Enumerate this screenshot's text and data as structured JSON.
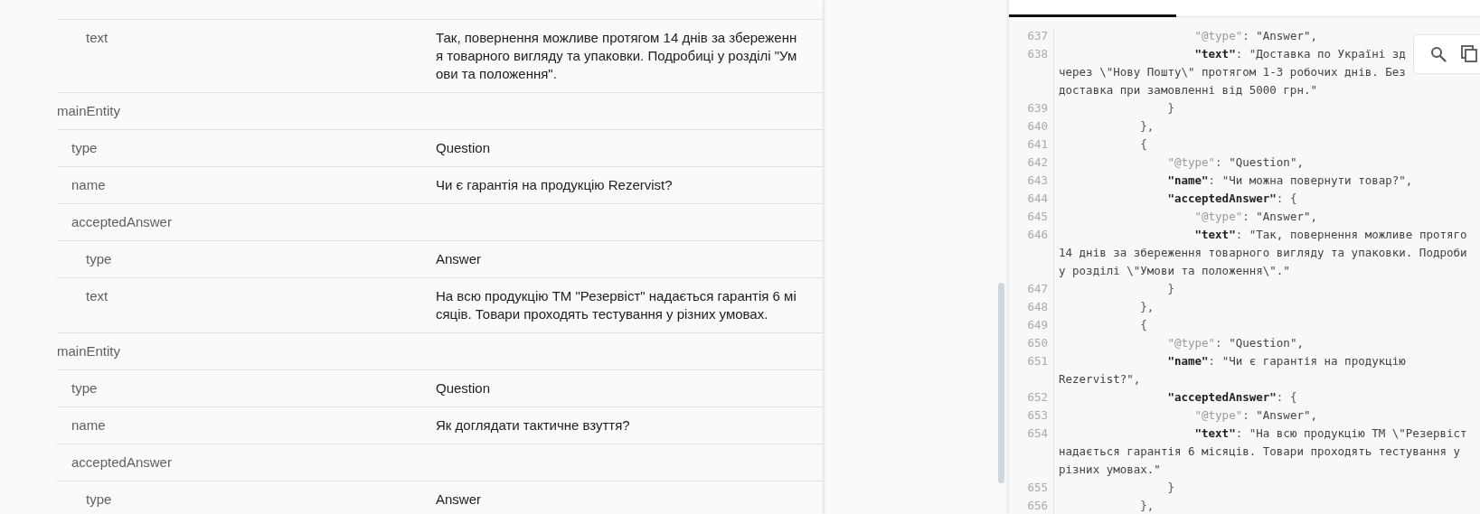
{
  "table": {
    "rows": [
      {
        "children": [
          {
            "children": [
              {
                "key": "text",
                "value": "Так, повернення можливе протягом 14 днів за збереження товарного вигляду та упаковки. Подробиці у розділі \"Умови та положення\"."
              }
            ]
          }
        ]
      },
      {
        "key": "mainEntity",
        "children": [
          {
            "key": "type",
            "value": "Question"
          },
          {
            "key": "name",
            "value": "Чи є гарантія на продукцію Rezervist?"
          },
          {
            "key": "acceptedAnswer",
            "children": [
              {
                "key": "type",
                "value": "Answer"
              },
              {
                "key": "text",
                "value": "На всю продукцію ТМ \"Резервіст\" надається гарантія 6 місяців. Товари проходять тестування у різних умовах."
              }
            ]
          }
        ]
      },
      {
        "key": "mainEntity",
        "children": [
          {
            "key": "type",
            "value": "Question"
          },
          {
            "key": "name",
            "value": "Як доглядати тактичне взуття?"
          },
          {
            "key": "acceptedAnswer",
            "children": [
              {
                "key": "type",
                "value": "Answer"
              }
            ]
          }
        ]
      }
    ]
  },
  "code": {
    "lines": [
      {
        "number": "637",
        "rows": [
          [
            {
              "kind": "meta",
              "text": "                    \"@type\""
            },
            {
              "kind": "punct",
              "text": ": "
            },
            {
              "kind": "value",
              "text": "\"Answer\","
            }
          ]
        ]
      },
      {
        "number": "638",
        "rows": [
          [
            {
              "kind": "key",
              "text": "                    \"text\""
            },
            {
              "kind": "punct",
              "text": ": "
            },
            {
              "kind": "value",
              "text": "\"Доставка по Україні зд"
            }
          ],
          [
            {
              "kind": "value",
              "text": "через \\\"Нову Пошту\\\" протягом 1-3 робочих днів. Без"
            }
          ],
          [
            {
              "kind": "value",
              "text": "доставка при замовленні від 5000 грн.\""
            }
          ]
        ]
      },
      {
        "number": "639",
        "rows": [
          [
            {
              "kind": "punct",
              "text": "                }"
            }
          ]
        ]
      },
      {
        "number": "640",
        "rows": [
          [
            {
              "kind": "punct",
              "text": "            },"
            }
          ]
        ]
      },
      {
        "number": "641",
        "rows": [
          [
            {
              "kind": "punct",
              "text": "            {"
            }
          ]
        ]
      },
      {
        "number": "642",
        "rows": [
          [
            {
              "kind": "meta",
              "text": "                \"@type\""
            },
            {
              "kind": "punct",
              "text": ": "
            },
            {
              "kind": "value",
              "text": "\"Question\","
            }
          ]
        ]
      },
      {
        "number": "643",
        "rows": [
          [
            {
              "kind": "key",
              "text": "                \"name\""
            },
            {
              "kind": "punct",
              "text": ": "
            },
            {
              "kind": "value",
              "text": "\"Чи можна повернути товар?\","
            }
          ]
        ]
      },
      {
        "number": "644",
        "rows": [
          [
            {
              "kind": "key",
              "text": "                \"acceptedAnswer\""
            },
            {
              "kind": "punct",
              "text": ": {"
            }
          ]
        ]
      },
      {
        "number": "645",
        "rows": [
          [
            {
              "kind": "meta",
              "text": "                    \"@type\""
            },
            {
              "kind": "punct",
              "text": ": "
            },
            {
              "kind": "value",
              "text": "\"Answer\","
            }
          ]
        ]
      },
      {
        "number": "646",
        "rows": [
          [
            {
              "kind": "key",
              "text": "                    \"text\""
            },
            {
              "kind": "punct",
              "text": ": "
            },
            {
              "kind": "value",
              "text": "\"Так, повернення можливе протяго"
            }
          ],
          [
            {
              "kind": "value",
              "text": "14 днів за збереження товарного вигляду та упаковки. Подроби"
            }
          ],
          [
            {
              "kind": "value",
              "text": "у розділі \\\"Умови та положення\\\".\""
            }
          ]
        ]
      },
      {
        "number": "647",
        "rows": [
          [
            {
              "kind": "punct",
              "text": "                }"
            }
          ]
        ]
      },
      {
        "number": "648",
        "rows": [
          [
            {
              "kind": "punct",
              "text": "            },"
            }
          ]
        ]
      },
      {
        "number": "649",
        "rows": [
          [
            {
              "kind": "punct",
              "text": "            {"
            }
          ]
        ]
      },
      {
        "number": "650",
        "rows": [
          [
            {
              "kind": "meta",
              "text": "                \"@type\""
            },
            {
              "kind": "punct",
              "text": ": "
            },
            {
              "kind": "value",
              "text": "\"Question\","
            }
          ]
        ]
      },
      {
        "number": "651",
        "rows": [
          [
            {
              "kind": "key",
              "text": "                \"name\""
            },
            {
              "kind": "punct",
              "text": ": "
            },
            {
              "kind": "value",
              "text": "\"Чи є гарантія на продукцію"
            }
          ],
          [
            {
              "kind": "value",
              "text": "Rezervist?\","
            }
          ]
        ]
      },
      {
        "number": "652",
        "rows": [
          [
            {
              "kind": "key",
              "text": "                \"acceptedAnswer\""
            },
            {
              "kind": "punct",
              "text": ": {"
            }
          ]
        ]
      },
      {
        "number": "653",
        "rows": [
          [
            {
              "kind": "meta",
              "text": "                    \"@type\""
            },
            {
              "kind": "punct",
              "text": ": "
            },
            {
              "kind": "value",
              "text": "\"Answer\","
            }
          ]
        ]
      },
      {
        "number": "654",
        "rows": [
          [
            {
              "kind": "key",
              "text": "                    \"text\""
            },
            {
              "kind": "punct",
              "text": ": "
            },
            {
              "kind": "value",
              "text": "\"На всю продукцію ТМ \\\"Резервіст"
            }
          ],
          [
            {
              "kind": "value",
              "text": "надається гарантія 6 місяців. Товари проходять тестування у"
            }
          ],
          [
            {
              "kind": "value",
              "text": "різних умовах.\""
            }
          ]
        ]
      },
      {
        "number": "655",
        "rows": [
          [
            {
              "kind": "punct",
              "text": "                }"
            }
          ]
        ]
      },
      {
        "number": "656",
        "rows": [
          [
            {
              "kind": "punct",
              "text": "            },"
            }
          ]
        ]
      }
    ]
  }
}
